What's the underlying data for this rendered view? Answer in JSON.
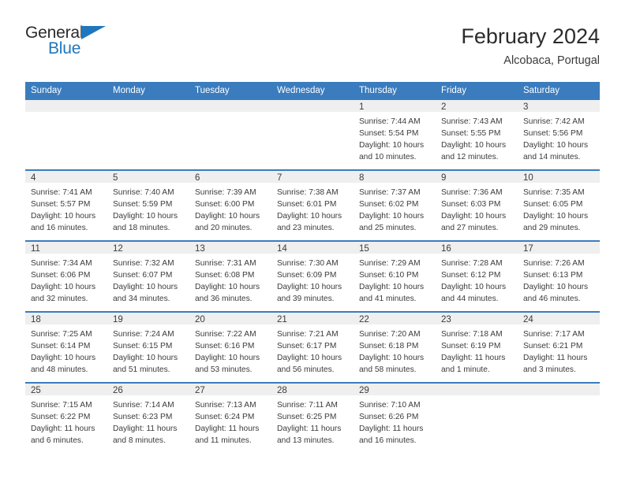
{
  "brand": {
    "name_top": "General",
    "name_bottom": "Blue",
    "accent_color": "#1f77bd",
    "triangle_icon": "logo-triangle-icon"
  },
  "header": {
    "title": "February 2024",
    "subtitle": "Alcobaca, Portugal",
    "header_bg_color": "#3a7cbe",
    "daynum_bg_color": "#efefef"
  },
  "weekdays": [
    "Sunday",
    "Monday",
    "Tuesday",
    "Wednesday",
    "Thursday",
    "Friday",
    "Saturday"
  ],
  "weeks": [
    [
      {
        "day": "",
        "empty": true
      },
      {
        "day": "",
        "empty": true
      },
      {
        "day": "",
        "empty": true
      },
      {
        "day": "",
        "empty": true
      },
      {
        "day": "1",
        "sunrise": "Sunrise: 7:44 AM",
        "sunset": "Sunset: 5:54 PM",
        "daylight_1": "Daylight: 10 hours",
        "daylight_2": "and 10 minutes."
      },
      {
        "day": "2",
        "sunrise": "Sunrise: 7:43 AM",
        "sunset": "Sunset: 5:55 PM",
        "daylight_1": "Daylight: 10 hours",
        "daylight_2": "and 12 minutes."
      },
      {
        "day": "3",
        "sunrise": "Sunrise: 7:42 AM",
        "sunset": "Sunset: 5:56 PM",
        "daylight_1": "Daylight: 10 hours",
        "daylight_2": "and 14 minutes."
      }
    ],
    [
      {
        "day": "4",
        "sunrise": "Sunrise: 7:41 AM",
        "sunset": "Sunset: 5:57 PM",
        "daylight_1": "Daylight: 10 hours",
        "daylight_2": "and 16 minutes."
      },
      {
        "day": "5",
        "sunrise": "Sunrise: 7:40 AM",
        "sunset": "Sunset: 5:59 PM",
        "daylight_1": "Daylight: 10 hours",
        "daylight_2": "and 18 minutes."
      },
      {
        "day": "6",
        "sunrise": "Sunrise: 7:39 AM",
        "sunset": "Sunset: 6:00 PM",
        "daylight_1": "Daylight: 10 hours",
        "daylight_2": "and 20 minutes."
      },
      {
        "day": "7",
        "sunrise": "Sunrise: 7:38 AM",
        "sunset": "Sunset: 6:01 PM",
        "daylight_1": "Daylight: 10 hours",
        "daylight_2": "and 23 minutes."
      },
      {
        "day": "8",
        "sunrise": "Sunrise: 7:37 AM",
        "sunset": "Sunset: 6:02 PM",
        "daylight_1": "Daylight: 10 hours",
        "daylight_2": "and 25 minutes."
      },
      {
        "day": "9",
        "sunrise": "Sunrise: 7:36 AM",
        "sunset": "Sunset: 6:03 PM",
        "daylight_1": "Daylight: 10 hours",
        "daylight_2": "and 27 minutes."
      },
      {
        "day": "10",
        "sunrise": "Sunrise: 7:35 AM",
        "sunset": "Sunset: 6:05 PM",
        "daylight_1": "Daylight: 10 hours",
        "daylight_2": "and 29 minutes."
      }
    ],
    [
      {
        "day": "11",
        "sunrise": "Sunrise: 7:34 AM",
        "sunset": "Sunset: 6:06 PM",
        "daylight_1": "Daylight: 10 hours",
        "daylight_2": "and 32 minutes."
      },
      {
        "day": "12",
        "sunrise": "Sunrise: 7:32 AM",
        "sunset": "Sunset: 6:07 PM",
        "daylight_1": "Daylight: 10 hours",
        "daylight_2": "and 34 minutes."
      },
      {
        "day": "13",
        "sunrise": "Sunrise: 7:31 AM",
        "sunset": "Sunset: 6:08 PM",
        "daylight_1": "Daylight: 10 hours",
        "daylight_2": "and 36 minutes."
      },
      {
        "day": "14",
        "sunrise": "Sunrise: 7:30 AM",
        "sunset": "Sunset: 6:09 PM",
        "daylight_1": "Daylight: 10 hours",
        "daylight_2": "and 39 minutes."
      },
      {
        "day": "15",
        "sunrise": "Sunrise: 7:29 AM",
        "sunset": "Sunset: 6:10 PM",
        "daylight_1": "Daylight: 10 hours",
        "daylight_2": "and 41 minutes."
      },
      {
        "day": "16",
        "sunrise": "Sunrise: 7:28 AM",
        "sunset": "Sunset: 6:12 PM",
        "daylight_1": "Daylight: 10 hours",
        "daylight_2": "and 44 minutes."
      },
      {
        "day": "17",
        "sunrise": "Sunrise: 7:26 AM",
        "sunset": "Sunset: 6:13 PM",
        "daylight_1": "Daylight: 10 hours",
        "daylight_2": "and 46 minutes."
      }
    ],
    [
      {
        "day": "18",
        "sunrise": "Sunrise: 7:25 AM",
        "sunset": "Sunset: 6:14 PM",
        "daylight_1": "Daylight: 10 hours",
        "daylight_2": "and 48 minutes."
      },
      {
        "day": "19",
        "sunrise": "Sunrise: 7:24 AM",
        "sunset": "Sunset: 6:15 PM",
        "daylight_1": "Daylight: 10 hours",
        "daylight_2": "and 51 minutes."
      },
      {
        "day": "20",
        "sunrise": "Sunrise: 7:22 AM",
        "sunset": "Sunset: 6:16 PM",
        "daylight_1": "Daylight: 10 hours",
        "daylight_2": "and 53 minutes."
      },
      {
        "day": "21",
        "sunrise": "Sunrise: 7:21 AM",
        "sunset": "Sunset: 6:17 PM",
        "daylight_1": "Daylight: 10 hours",
        "daylight_2": "and 56 minutes."
      },
      {
        "day": "22",
        "sunrise": "Sunrise: 7:20 AM",
        "sunset": "Sunset: 6:18 PM",
        "daylight_1": "Daylight: 10 hours",
        "daylight_2": "and 58 minutes."
      },
      {
        "day": "23",
        "sunrise": "Sunrise: 7:18 AM",
        "sunset": "Sunset: 6:19 PM",
        "daylight_1": "Daylight: 11 hours",
        "daylight_2": "and 1 minute."
      },
      {
        "day": "24",
        "sunrise": "Sunrise: 7:17 AM",
        "sunset": "Sunset: 6:21 PM",
        "daylight_1": "Daylight: 11 hours",
        "daylight_2": "and 3 minutes."
      }
    ],
    [
      {
        "day": "25",
        "sunrise": "Sunrise: 7:15 AM",
        "sunset": "Sunset: 6:22 PM",
        "daylight_1": "Daylight: 11 hours",
        "daylight_2": "and 6 minutes."
      },
      {
        "day": "26",
        "sunrise": "Sunrise: 7:14 AM",
        "sunset": "Sunset: 6:23 PM",
        "daylight_1": "Daylight: 11 hours",
        "daylight_2": "and 8 minutes."
      },
      {
        "day": "27",
        "sunrise": "Sunrise: 7:13 AM",
        "sunset": "Sunset: 6:24 PM",
        "daylight_1": "Daylight: 11 hours",
        "daylight_2": "and 11 minutes."
      },
      {
        "day": "28",
        "sunrise": "Sunrise: 7:11 AM",
        "sunset": "Sunset: 6:25 PM",
        "daylight_1": "Daylight: 11 hours",
        "daylight_2": "and 13 minutes."
      },
      {
        "day": "29",
        "sunrise": "Sunrise: 7:10 AM",
        "sunset": "Sunset: 6:26 PM",
        "daylight_1": "Daylight: 11 hours",
        "daylight_2": "and 16 minutes."
      },
      {
        "day": "",
        "empty": true
      },
      {
        "day": "",
        "empty": true
      }
    ]
  ]
}
